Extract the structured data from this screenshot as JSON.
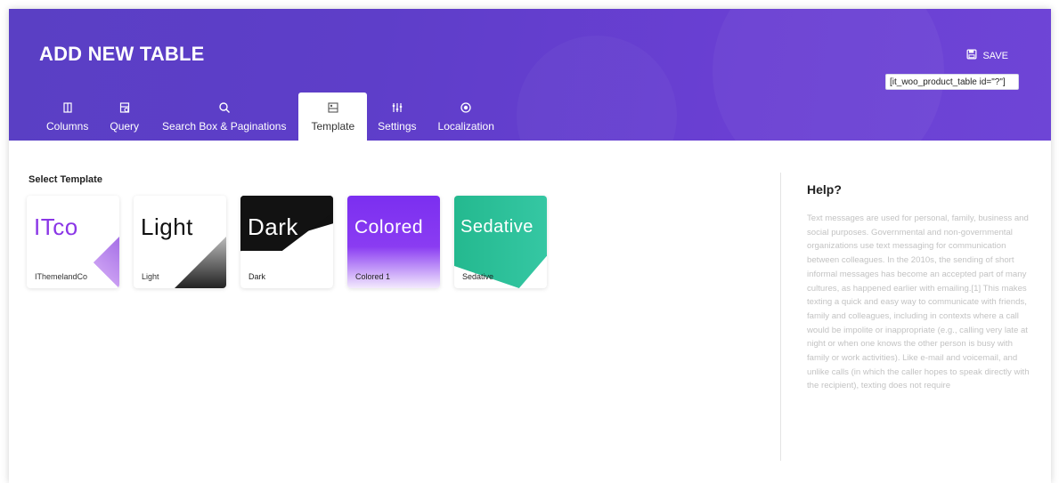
{
  "header": {
    "title": "ADD NEW TABLE",
    "save_label": "SAVE",
    "shortcode": "[it_woo_product_table id=\"?\"]"
  },
  "tabs": [
    {
      "label": "Columns",
      "icon": "columns-icon"
    },
    {
      "label": "Query",
      "icon": "query-icon"
    },
    {
      "label": "Search Box & Paginations",
      "icon": "search-icon"
    },
    {
      "label": "Template",
      "icon": "template-icon",
      "active": true
    },
    {
      "label": "Settings",
      "icon": "settings-sliders-icon"
    },
    {
      "label": "Localization",
      "icon": "localization-icon"
    }
  ],
  "content": {
    "select_template_label": "Select Template",
    "templates": [
      {
        "preview": "ITco",
        "name": "IThemelandCo"
      },
      {
        "preview": "Light",
        "name": "Light"
      },
      {
        "preview": "Dark",
        "name": "Dark"
      },
      {
        "preview": "Colored",
        "name": "Colored 1"
      },
      {
        "preview": "Sedative",
        "name": "Sedative"
      }
    ]
  },
  "help": {
    "title": "Help?",
    "text": "Text messages are used for personal, family, business and social purposes. Governmental and non-governmental organizations use text messaging for communication between colleagues. In the 2010s, the sending of short informal messages has become an accepted part of many cultures, as happened earlier with emailing.[1] This makes texting a quick and easy way to communicate with friends, family and colleagues, including in contexts where a call would be impolite or inappropriate (e.g., calling very late at night or when one knows the other person is busy with family or work activities). Like e-mail and voicemail, and unlike calls (in which the caller hopes to speak directly with the recipient), texting does not require"
  },
  "colors": {
    "header_start": "#5a3fc4",
    "header_end": "#6e45d6",
    "accent": "#8a36e6"
  }
}
